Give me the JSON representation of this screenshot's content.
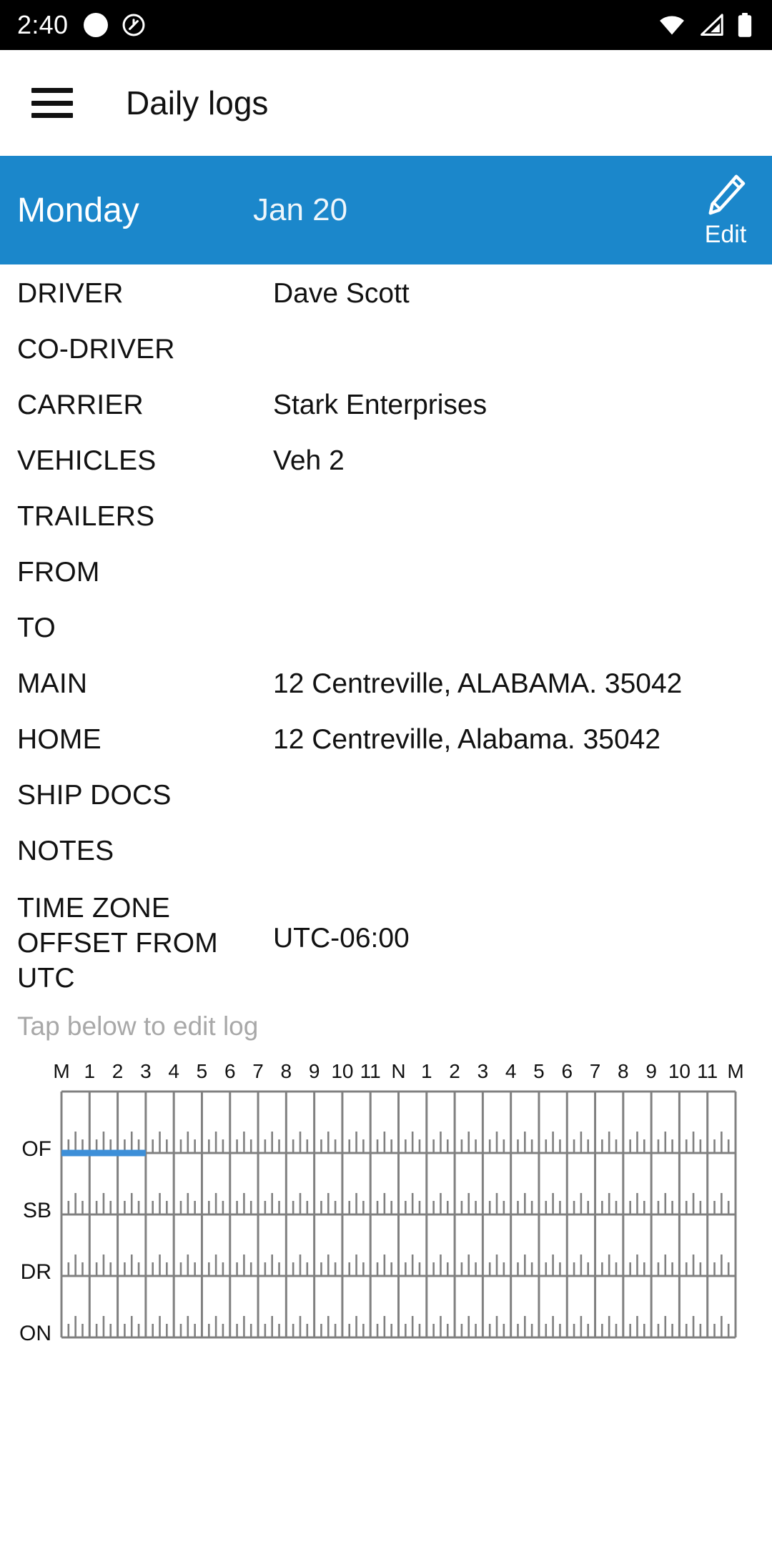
{
  "statusbar": {
    "clock": "2:40",
    "left_icons": [
      "circle-indicator-icon",
      "do-not-disturb-icon"
    ],
    "right_icons": [
      "wifi-icon",
      "cellular-signal-icon",
      "battery-icon"
    ]
  },
  "appbar": {
    "menu_icon": "hamburger-menu-icon",
    "title": "Daily logs"
  },
  "date_header": {
    "day": "Monday",
    "date": "Jan 20",
    "edit_label": "Edit",
    "edit_icon": "pencil-edit-icon",
    "background_color": "#1b87cb"
  },
  "info_rows": [
    {
      "label": "DRIVER",
      "value": "Dave Scott"
    },
    {
      "label": "CO-DRIVER",
      "value": ""
    },
    {
      "label": "CARRIER",
      "value": "Stark Enterprises"
    },
    {
      "label": "VEHICLES",
      "value": "Veh 2"
    },
    {
      "label": "TRAILERS",
      "value": ""
    },
    {
      "label": "FROM",
      "value": ""
    },
    {
      "label": "TO",
      "value": ""
    },
    {
      "label": "MAIN",
      "value": "12 Centreville, ALABAMA. 35042"
    },
    {
      "label": "HOME",
      "value": "12 Centreville, Alabama. 35042"
    },
    {
      "label": "SHIP DOCS",
      "value": ""
    },
    {
      "label": "NOTES",
      "value": ""
    },
    {
      "label": "TIME ZONE OFFSET FROM UTC",
      "value": "UTC-06:00"
    }
  ],
  "tap_hint": "Tap below to edit log",
  "chart_data": {
    "type": "table",
    "title": "Driver duty status log grid",
    "hour_labels": [
      "M",
      "1",
      "2",
      "3",
      "4",
      "5",
      "6",
      "7",
      "8",
      "9",
      "10",
      "11",
      "N",
      "1",
      "2",
      "3",
      "4",
      "5",
      "6",
      "7",
      "8",
      "9",
      "10",
      "11",
      "M"
    ],
    "duty_rows": [
      "OF",
      "SB",
      "DR",
      "ON"
    ],
    "grid_line_color": "#808080",
    "duty_line_color": "#3d8fd8",
    "segments": [
      {
        "status": "OF",
        "start_hour": 0,
        "end_hour": 3
      }
    ],
    "xlim": [
      0,
      24
    ],
    "grid": true,
    "tick_minutes": [
      15,
      30,
      45
    ]
  }
}
